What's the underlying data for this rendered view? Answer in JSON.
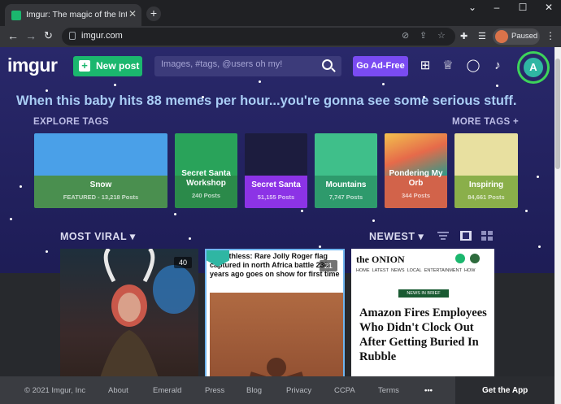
{
  "browser": {
    "tab_title": "Imgur: The magic of the Internet",
    "url": "imgur.com",
    "profile_label": "Paused"
  },
  "header": {
    "logo": "imgur",
    "new_post": "New post",
    "search_placeholder": "Images, #tags, @users oh my!",
    "ad_free": "Go Ad-Free",
    "avatar_letter": "A"
  },
  "tagline": "When this baby hits 88 memes per hour...you're gonna see some serious stuff.",
  "explore": {
    "label": "EXPLORE TAGS",
    "more": "MORE TAGS +",
    "tags": [
      {
        "name": "Snow",
        "count": "FEATURED - 13,218 Posts",
        "top_color": "#4aa0e8",
        "bottom_color": "#4a8f4f"
      },
      {
        "name": "Secret Santa Workshop",
        "count": "240 Posts",
        "top_color": "#29a35a",
        "bottom_color": "#2b8a4a"
      },
      {
        "name": "Secret Santa",
        "count": "51,155 Posts",
        "top_color": "#1c1c3e",
        "bottom_color": "#8c33e6"
      },
      {
        "name": "Mountains",
        "count": "7,747 Posts",
        "top_color": "#3fbf8a",
        "bottom_color": "#2e9a6c"
      },
      {
        "name": "Pondering My Orb",
        "count": "344 Posts",
        "top_color": "#e66a4a",
        "bottom_color": "#d2634a"
      },
      {
        "name": "Inspiring",
        "count": "84,661 Posts",
        "top_color": "#e8e0a0",
        "bottom_color": "#8aaf4a"
      }
    ]
  },
  "feed": {
    "section": "MOST VIRAL",
    "sort": "NEWEST",
    "cards": [
      {
        "count": "40"
      },
      {
        "count": "21",
        "title": "for ruthless: Rare Jolly Roger flag captured in north Africa battle 230 years ago goes on show for first time"
      },
      {
        "outlet": "the ONION",
        "nav": [
          "HOME",
          "LATEST",
          "NEWS",
          "LOCAL",
          "ENTERTAINMENT",
          "HOW"
        ],
        "badge": "NEWS IN BRIEF",
        "headline": "Amazon Fires Employees Who Didn't Clock Out After Getting Buried In Rubble"
      }
    ]
  },
  "footer": {
    "copyright": "© 2021 Imgur, Inc",
    "links": [
      "About",
      "Emerald",
      "Press",
      "Blog",
      "Privacy",
      "CCPA",
      "Terms"
    ],
    "more": "•••",
    "get_app": "Get the App"
  }
}
